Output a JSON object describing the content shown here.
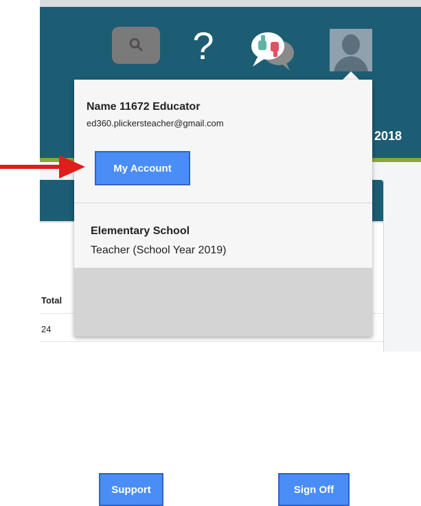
{
  "header": {
    "year_fragment": "2018",
    "icons": {
      "search": "search-icon",
      "help": "help-icon",
      "feedback": "feedback-icon",
      "avatar": "avatar-icon"
    },
    "help_glyph": "?"
  },
  "table": {
    "total_label": "Total",
    "total_value": "24"
  },
  "account_menu": {
    "user_name": "Name 11672 Educator",
    "email": "ed360.plickersteacher@gmail.com",
    "my_account_label": "My Account",
    "school_name": "Elementary School",
    "role": "Teacher (School Year 2019)",
    "support_label": "Support",
    "sign_off_label": "Sign Off"
  },
  "colors": {
    "header_bg": "#1c5d73",
    "accent_line": "#8ea33b",
    "button_blue": "#4b8df7",
    "annotation_red": "#e11c1c"
  }
}
